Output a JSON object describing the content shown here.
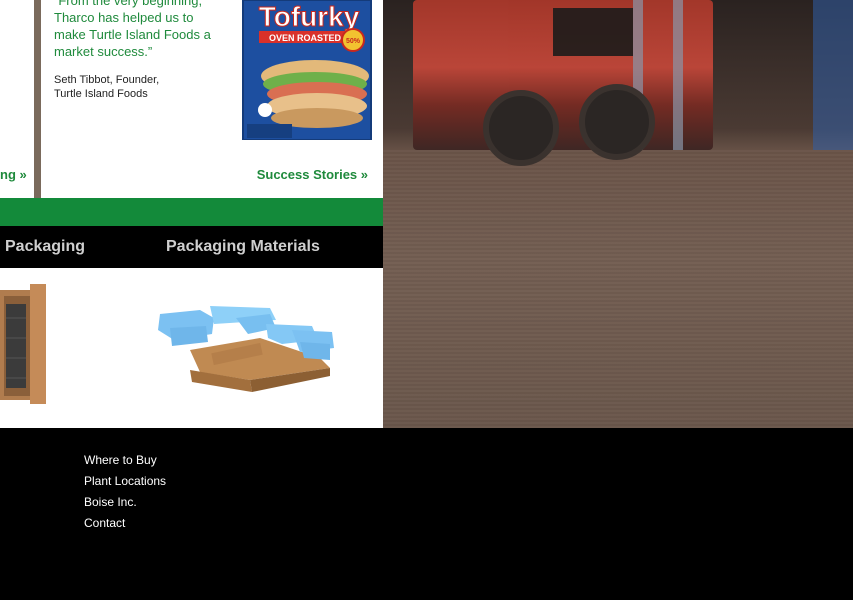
{
  "testimonial": {
    "quote_lines": [
      "“From the very beginning,",
      "Tharco has helped us to",
      "make Turtle Island Foods a",
      "market success.”"
    ],
    "author_name": "Seth Tibbot, Founder,",
    "author_company": "Turtle Island Foods",
    "link": "Success Stories »"
  },
  "left_panel": {
    "cut_link": "ng »"
  },
  "product_box": {
    "brand": "Tofurky",
    "subtitle": "OVEN ROASTED",
    "badge": "50%"
  },
  "categories": [
    {
      "label": "Packaging"
    },
    {
      "label": "Packaging Materials"
    }
  ],
  "footer": {
    "links": [
      {
        "label": "Where to Buy"
      },
      {
        "label": "Plant Locations"
      },
      {
        "label": "Boise Inc."
      },
      {
        "label": "Contact"
      }
    ]
  },
  "colors": {
    "brand_green": "#138a3a",
    "link_green": "#1f8a3c",
    "background": "#000000"
  }
}
